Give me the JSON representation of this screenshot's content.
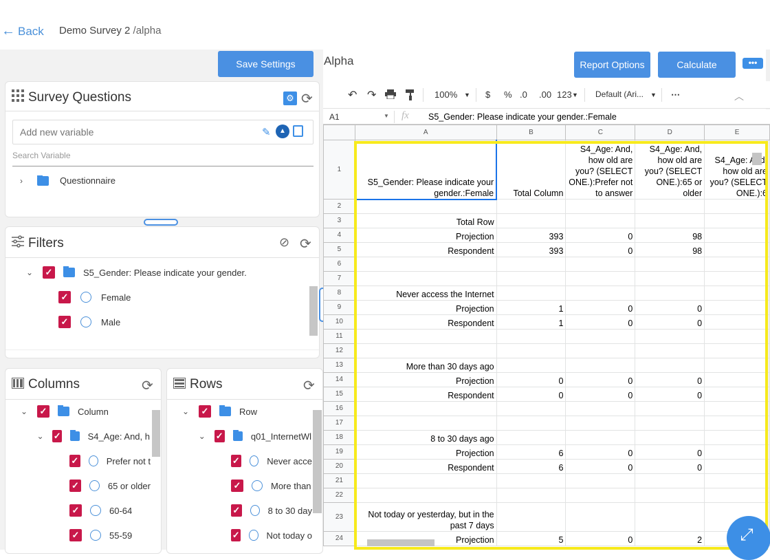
{
  "header": {
    "back_label": "Back",
    "survey_name": "Demo Survey 2",
    "survey_sub": " /alpha"
  },
  "save_settings_label": "Save Settings",
  "survey_questions": {
    "title": "Survey Questions",
    "add_placeholder": "Add new variable",
    "search_label": "Search Variable",
    "tree_root": "Questionnaire"
  },
  "filters": {
    "title": "Filters",
    "question": "S5_Gender: Please indicate your gender.",
    "options": [
      "Female",
      "Male"
    ]
  },
  "columns": {
    "title": "Columns",
    "root": "Column",
    "question": "S4_Age: And, h",
    "options": [
      "Prefer not t",
      "65 or older",
      "60-64",
      "55-59"
    ]
  },
  "rows": {
    "title": "Rows",
    "root": "Row",
    "question": "q01_InternetWl",
    "options": [
      "Never acce",
      "More than",
      "8 to 30 day",
      "Not today o"
    ]
  },
  "report": {
    "title": "Alpha",
    "report_options_label": "Report Options",
    "calculate_label": "Calculate"
  },
  "toolbar": {
    "zoom": "100%",
    "currency": "$",
    "percent": "%",
    "dec_less": ".0",
    "dec_more": ".00",
    "format": "123",
    "font": "Default (Ari...",
    "more": "⋯"
  },
  "formula_bar": {
    "cell_ref": "A1",
    "fx": "fx",
    "content": "S5_Gender: Please indicate your gender.:Female"
  },
  "sheet": {
    "col_headers": [
      "A",
      "B",
      "C",
      "D",
      "E"
    ],
    "rows": [
      {
        "n": "1",
        "cells": [
          "S5_Gender: Please indicate your gender.:Female",
          "Total Column",
          "S4_Age: And, how old are you? (SELECT ONE.):Prefer not to answer",
          "S4_Age: And, how old are you? (SELECT ONE.):65 or older",
          "S4_Age: And, how old are you? (SELECT ONE.):6"
        ]
      },
      {
        "n": "2",
        "cells": [
          "",
          "",
          "",
          "",
          ""
        ]
      },
      {
        "n": "3",
        "cells": [
          "Total Row",
          "",
          "",
          "",
          ""
        ]
      },
      {
        "n": "4",
        "cells": [
          "Projection",
          "393",
          "0",
          "98",
          ""
        ]
      },
      {
        "n": "5",
        "cells": [
          "Respondent",
          "393",
          "0",
          "98",
          ""
        ]
      },
      {
        "n": "6",
        "cells": [
          "",
          "",
          "",
          "",
          ""
        ]
      },
      {
        "n": "7",
        "cells": [
          "",
          "",
          "",
          "",
          ""
        ]
      },
      {
        "n": "8",
        "cells": [
          "Never access the Internet",
          "",
          "",
          "",
          ""
        ]
      },
      {
        "n": "9",
        "cells": [
          "Projection",
          "1",
          "0",
          "0",
          ""
        ]
      },
      {
        "n": "10",
        "cells": [
          "Respondent",
          "1",
          "0",
          "0",
          ""
        ]
      },
      {
        "n": "11",
        "cells": [
          "",
          "",
          "",
          "",
          ""
        ]
      },
      {
        "n": "12",
        "cells": [
          "",
          "",
          "",
          "",
          ""
        ]
      },
      {
        "n": "13",
        "cells": [
          "More than 30 days ago",
          "",
          "",
          "",
          ""
        ]
      },
      {
        "n": "14",
        "cells": [
          "Projection",
          "0",
          "0",
          "0",
          ""
        ]
      },
      {
        "n": "15",
        "cells": [
          "Respondent",
          "0",
          "0",
          "0",
          ""
        ]
      },
      {
        "n": "16",
        "cells": [
          "",
          "",
          "",
          "",
          ""
        ]
      },
      {
        "n": "17",
        "cells": [
          "",
          "",
          "",
          "",
          ""
        ]
      },
      {
        "n": "18",
        "cells": [
          "8 to 30 days ago",
          "",
          "",
          "",
          ""
        ]
      },
      {
        "n": "19",
        "cells": [
          "Projection",
          "6",
          "0",
          "0",
          ""
        ]
      },
      {
        "n": "20",
        "cells": [
          "Respondent",
          "6",
          "0",
          "0",
          ""
        ]
      },
      {
        "n": "21",
        "cells": [
          "",
          "",
          "",
          "",
          ""
        ]
      },
      {
        "n": "22",
        "cells": [
          "",
          "",
          "",
          "",
          ""
        ]
      },
      {
        "n": "23",
        "cells": [
          "Not today or yesterday, but in the past 7 days",
          "",
          "",
          "",
          ""
        ]
      },
      {
        "n": "24",
        "cells": [
          "Projection",
          "5",
          "0",
          "2",
          ""
        ]
      }
    ]
  }
}
